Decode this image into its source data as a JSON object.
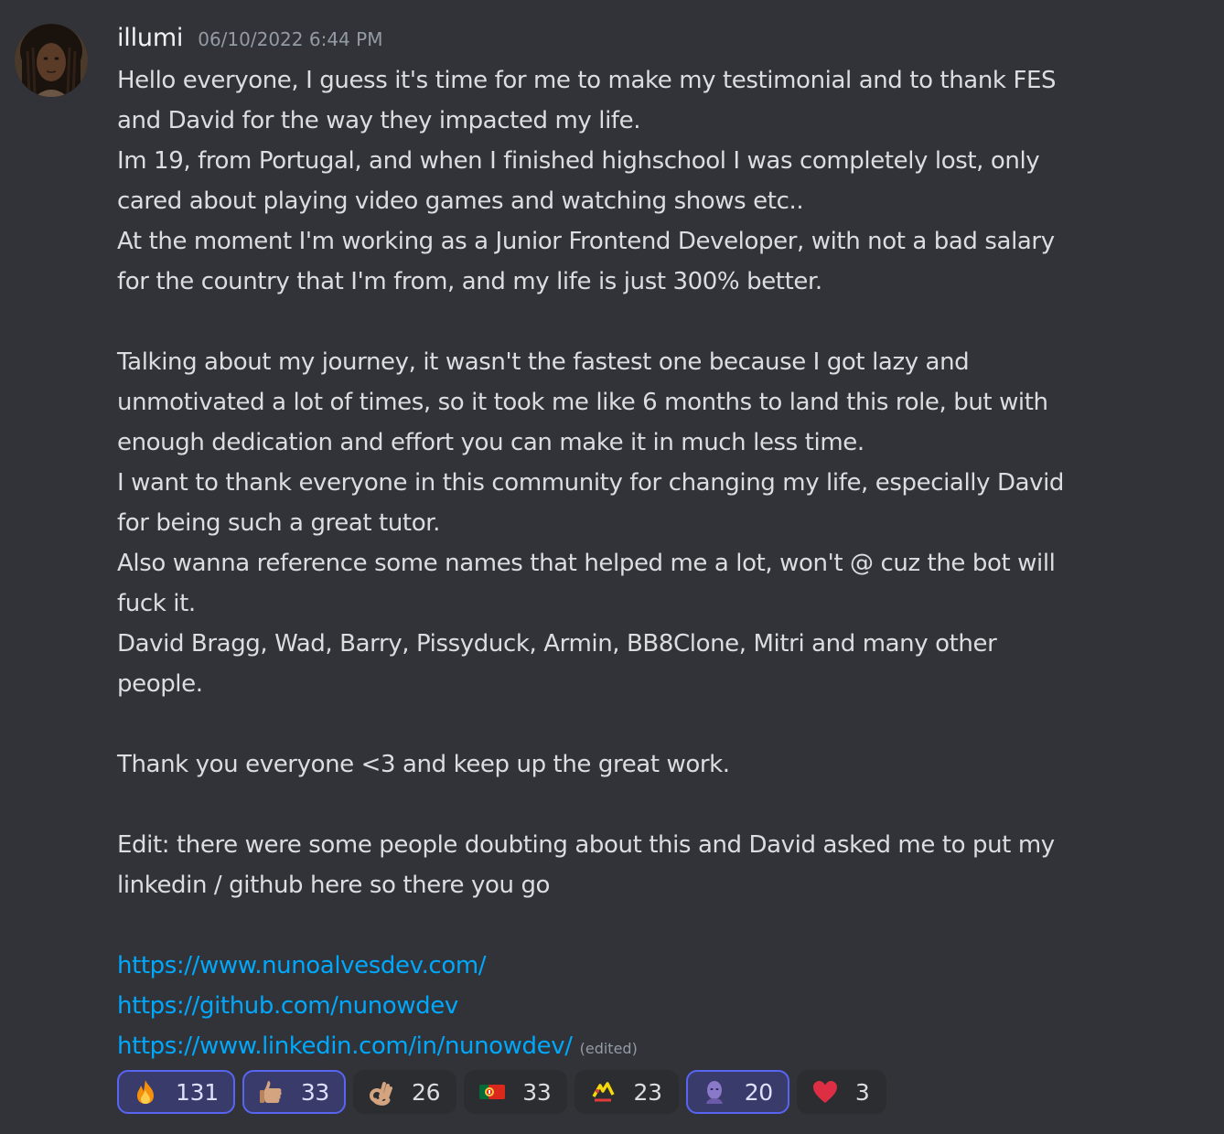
{
  "message": {
    "author": "illumi",
    "timestamp": "06/10/2022 6:44 PM",
    "lines": [
      "Hello everyone, I guess it's time for me to make my testimonial and to thank FES",
      "and David for the way they impacted my life.",
      "Im 19, from Portugal, and when I finished highschool I was completely lost, only",
      "cared about playing video games and watching shows etc..",
      "At the moment I'm working as a Junior Frontend Developer, with not a bad salary",
      "for the country that I'm from, and my life is just 300% better.",
      "",
      "Talking about my journey, it wasn't the fastest one because I got lazy and",
      "unmotivated a lot of times, so it took me like 6 months to land this role, but with",
      "enough dedication and effort you can make it in much less time.",
      "I want to thank everyone in this community for changing my life, especially David",
      "for being such a great tutor.",
      "Also wanna reference some names that helped me a lot, won't @ cuz the bot will",
      "fuck it.",
      "David Bragg, Wad, Barry, Pissyduck, Armin, BB8Clone, Mitri and many other",
      "people.",
      "",
      "Thank you everyone <3 and keep up the great work.",
      "",
      "Edit: there were some people doubting about this and David asked me to put my",
      "linkedin / github here so there you go",
      ""
    ],
    "links": [
      "https://www.nunoalvesdev.com/",
      "https://github.com/nunowdev",
      "https://www.linkedin.com/in/nunowdev/"
    ],
    "edited_label": "(edited)"
  },
  "reactions": [
    {
      "emoji": "fire-emoji",
      "count": "131",
      "active": true
    },
    {
      "emoji": "thumbs-up-emoji",
      "count": "33",
      "active": true
    },
    {
      "emoji": "ok-hand-emoji",
      "count": "26",
      "active": false
    },
    {
      "emoji": "portugal-flag-emoji",
      "count": "33",
      "active": false
    },
    {
      "emoji": "custom-emoji",
      "count": "23",
      "active": false
    },
    {
      "emoji": "custom-avatar-emoji",
      "count": "20",
      "active": true
    },
    {
      "emoji": "red-heart-emoji",
      "count": "3",
      "active": false
    }
  ],
  "colors": {
    "background": "#313338",
    "text": "#dbdee1",
    "link": "#00a8fc",
    "muted": "#949ba4",
    "reaction_active_border": "#5865f2",
    "reaction_active_bg": "#393c6b",
    "reaction_bg": "#2b2d31"
  }
}
